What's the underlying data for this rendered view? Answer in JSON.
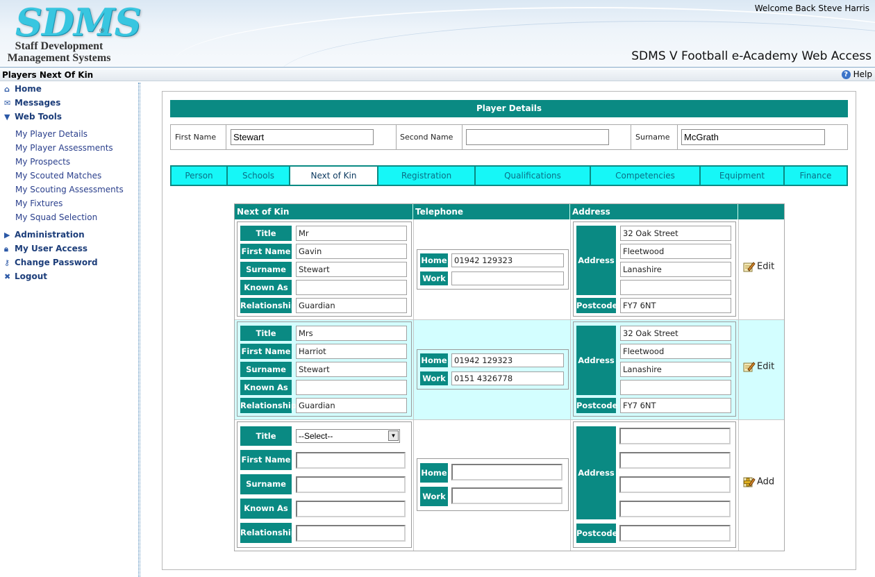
{
  "header": {
    "logo_text": "SDMS",
    "logo_subtitle_line1": "Staff Development",
    "logo_subtitle_line2": "Management Systems",
    "welcome": "Welcome Back Steve Harris",
    "app_title": "SDMS V Football e-Academy Web Access"
  },
  "titlebar": {
    "page_title": "Players Next Of Kin",
    "help": "Help"
  },
  "sidebar": {
    "main": [
      {
        "label": "Home",
        "icon": "home-icon"
      },
      {
        "label": "Messages",
        "icon": "messages-icon"
      },
      {
        "label": "Web Tools",
        "icon": "chevron-down-icon"
      },
      {
        "label": "Administration",
        "icon": "chevron-right-icon"
      },
      {
        "label": "My User Access",
        "icon": "lock-icon"
      },
      {
        "label": "Change Password",
        "icon": "key-icon"
      },
      {
        "label": "Logout",
        "icon": "close-icon"
      }
    ],
    "web_tools": [
      "My Player Details",
      "My Player Assessments",
      "My Prospects",
      "My Scouted Matches",
      "My Scouting Assessments",
      "My Fixtures",
      "My Squad Selection"
    ]
  },
  "player_details": {
    "header": "Player Details",
    "first_name_label": "First Name",
    "first_name": "Stewart",
    "second_name_label": "Second Name",
    "second_name": "",
    "surname_label": "Surname",
    "surname": "McGrath"
  },
  "tabs": [
    "Person",
    "Schools",
    "Next of Kin",
    "Registration",
    "Qualifications",
    "Competencies",
    "Equipment",
    "Finance"
  ],
  "active_tab": "Next of Kin",
  "nok": {
    "columns": [
      "Next of Kin",
      "Telephone",
      "Address",
      ""
    ],
    "labels": {
      "title": "Title",
      "first_name": "First Name",
      "surname": "Surname",
      "known_as": "Known As",
      "relationship": "Relationship",
      "home": "Home",
      "work": "Work",
      "address": "Address",
      "postcode": "Postcode"
    },
    "rows": [
      {
        "title": "Mr",
        "first_name": "Gavin",
        "surname": "Stewart",
        "known_as": "",
        "relationship": "Guardian",
        "home": "01942 129323",
        "work": "",
        "address": [
          "32 Oak Street",
          "Fleetwood",
          "Lanashire",
          ""
        ],
        "postcode": "FY7 6NT",
        "action": "Edit"
      },
      {
        "title": "Mrs",
        "first_name": "Harriot",
        "surname": "Stewart",
        "known_as": "",
        "relationship": "Guardian",
        "home": "01942 129323",
        "work": "0151 4326778",
        "address": [
          "32 Oak Street",
          "Fleetwood",
          "Lanashire",
          ""
        ],
        "postcode": "FY7 6NT",
        "action": "Edit"
      }
    ],
    "new_row": {
      "title_select": "--Select--",
      "action": "Add"
    }
  },
  "colors": {
    "teal": "#0a8a83",
    "tab_cyan": "#16f7f7",
    "alt_row": "#d3feff",
    "logo": "#38c6e0"
  }
}
